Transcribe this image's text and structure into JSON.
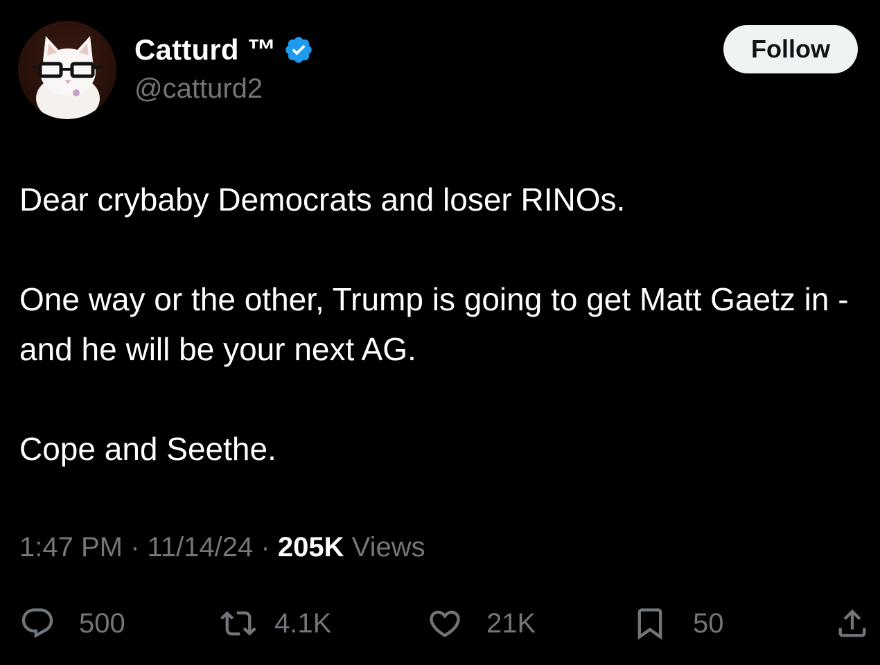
{
  "user": {
    "display_name": "Catturd ™",
    "handle": "@catturd2",
    "verified": true
  },
  "follow_button": {
    "label": "Follow"
  },
  "tweet": {
    "paragraphs": [
      "Dear crybaby Democrats and loser RINOs.",
      "One way or the other, Trump is going to get Matt Gaetz in - and he will be your next AG.",
      "Cope and Seethe."
    ],
    "time": "1:47 PM",
    "date": "11/14/24",
    "separator": "·",
    "views_count": "205K",
    "views_label": "Views"
  },
  "actions": {
    "reply": {
      "icon": "reply-icon",
      "count": "500"
    },
    "repost": {
      "icon": "repost-icon",
      "count": "4.1K"
    },
    "like": {
      "icon": "heart-icon",
      "count": "21K"
    },
    "bookmark": {
      "icon": "bookmark-icon",
      "count": "50"
    },
    "share": {
      "icon": "share-icon"
    }
  },
  "colors": {
    "background": "#000000",
    "text": "#ffffff",
    "muted": "#71767b",
    "verified": "#1d9bf0",
    "button_bg": "#eff3f4"
  }
}
